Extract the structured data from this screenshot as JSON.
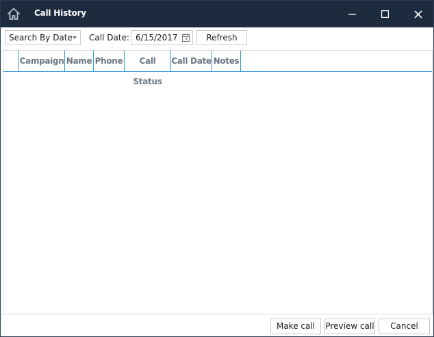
{
  "window": {
    "title": "Call History",
    "icons": {
      "home": "home-icon",
      "minimize": "minimize-icon",
      "maximize": "maximize-icon",
      "close": "close-icon"
    },
    "title_bg": "#1c2b3e",
    "accent": "#2e9bd3"
  },
  "toolbar": {
    "search_mode": "Search By Date",
    "call_date_label": "Call Date:",
    "call_date_value": "6/15/2017",
    "refresh_label": "Refresh"
  },
  "grid": {
    "columns": [
      "Campaign",
      "Name",
      "Phone",
      "Call Status",
      "Call Date",
      "Notes"
    ],
    "rows": []
  },
  "footer": {
    "make_call_label": "Make call",
    "preview_call_label": "Preview call",
    "cancel_label": "Cancel"
  }
}
